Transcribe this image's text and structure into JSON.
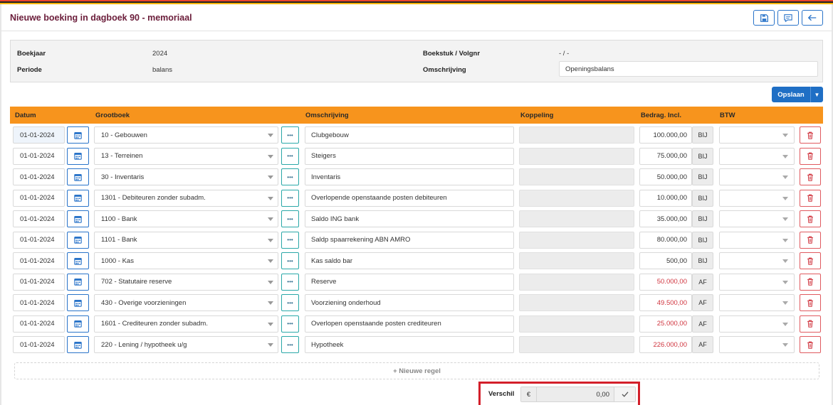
{
  "colors": {
    "title": "#6b1d3a",
    "header_bar": "#f7941d",
    "primary": "#1f6fc5",
    "negative": "#d0353f",
    "highlight_border": "#d31f2a"
  },
  "header": {
    "title": "Nieuwe boeking in dagboek 90 - memoriaal",
    "icons": [
      "save-icon",
      "comment-icon",
      "arrow-left-icon"
    ]
  },
  "info": {
    "boekjaar_label": "Boekjaar",
    "boekjaar_value": "2024",
    "periode_label": "Periode",
    "periode_value": "balans",
    "boekstuk_label": "Boekstuk / Volgnr",
    "boekstuk_value": "- / -",
    "omschrijving_label": "Omschrijving",
    "omschrijving_value": "Openingsbalans"
  },
  "save_button": {
    "label": "Opslaan"
  },
  "table": {
    "columns": [
      "Datum",
      "Grootboek",
      "Omschrijving",
      "Koppeling",
      "Bedrag. Incl.",
      "BTW"
    ],
    "rows": [
      {
        "datum": "01-01-2024",
        "grootboek": "10 - Gebouwen",
        "omschrijving": "Clubgebouw",
        "koppeling": "",
        "bedrag": "100.000,00",
        "type": "BIJ",
        "btw": ""
      },
      {
        "datum": "01-01-2024",
        "grootboek": "13 - Terreinen",
        "omschrijving": "Steigers",
        "koppeling": "",
        "bedrag": "75.000,00",
        "type": "BIJ",
        "btw": ""
      },
      {
        "datum": "01-01-2024",
        "grootboek": "30 - Inventaris",
        "omschrijving": "Inventaris",
        "koppeling": "",
        "bedrag": "50.000,00",
        "type": "BIJ",
        "btw": ""
      },
      {
        "datum": "01-01-2024",
        "grootboek": "1301 - Debiteuren zonder subadm.",
        "omschrijving": "Overlopende openstaande posten debiteuren",
        "koppeling": "",
        "bedrag": "10.000,00",
        "type": "BIJ",
        "btw": ""
      },
      {
        "datum": "01-01-2024",
        "grootboek": "1100 - Bank",
        "omschrijving": "Saldo ING bank",
        "koppeling": "",
        "bedrag": "35.000,00",
        "type": "BIJ",
        "btw": ""
      },
      {
        "datum": "01-01-2024",
        "grootboek": "1101 - Bank",
        "omschrijving": "Saldp spaarrekening ABN AMRO",
        "koppeling": "",
        "bedrag": "80.000,00",
        "type": "BIJ",
        "btw": ""
      },
      {
        "datum": "01-01-2024",
        "grootboek": "1000 - Kas",
        "omschrijving": "Kas saldo bar",
        "koppeling": "",
        "bedrag": "500,00",
        "type": "BIJ",
        "btw": ""
      },
      {
        "datum": "01-01-2024",
        "grootboek": "702 - Statutaire reserve",
        "omschrijving": "Reserve",
        "koppeling": "",
        "bedrag": "50.000,00",
        "type": "AF",
        "btw": ""
      },
      {
        "datum": "01-01-2024",
        "grootboek": "430 - Overige voorzieningen",
        "omschrijving": "Voorziening onderhoud",
        "koppeling": "",
        "bedrag": "49.500,00",
        "type": "AF",
        "btw": ""
      },
      {
        "datum": "01-01-2024",
        "grootboek": "1601 - Crediteuren zonder subadm.",
        "omschrijving": "Overlopen openstaande posten crediteuren",
        "koppeling": "",
        "bedrag": "25.000,00",
        "type": "AF",
        "btw": ""
      },
      {
        "datum": "01-01-2024",
        "grootboek": "220 - Lening / hypotheek u/g",
        "omschrijving": "Hypotheek",
        "koppeling": "",
        "bedrag": "226.000,00",
        "type": "AF",
        "btw": ""
      }
    ]
  },
  "new_row": {
    "label": "+ Nieuwe regel"
  },
  "verschil": {
    "label": "Verschil",
    "currency": "€",
    "value": "0,00"
  }
}
